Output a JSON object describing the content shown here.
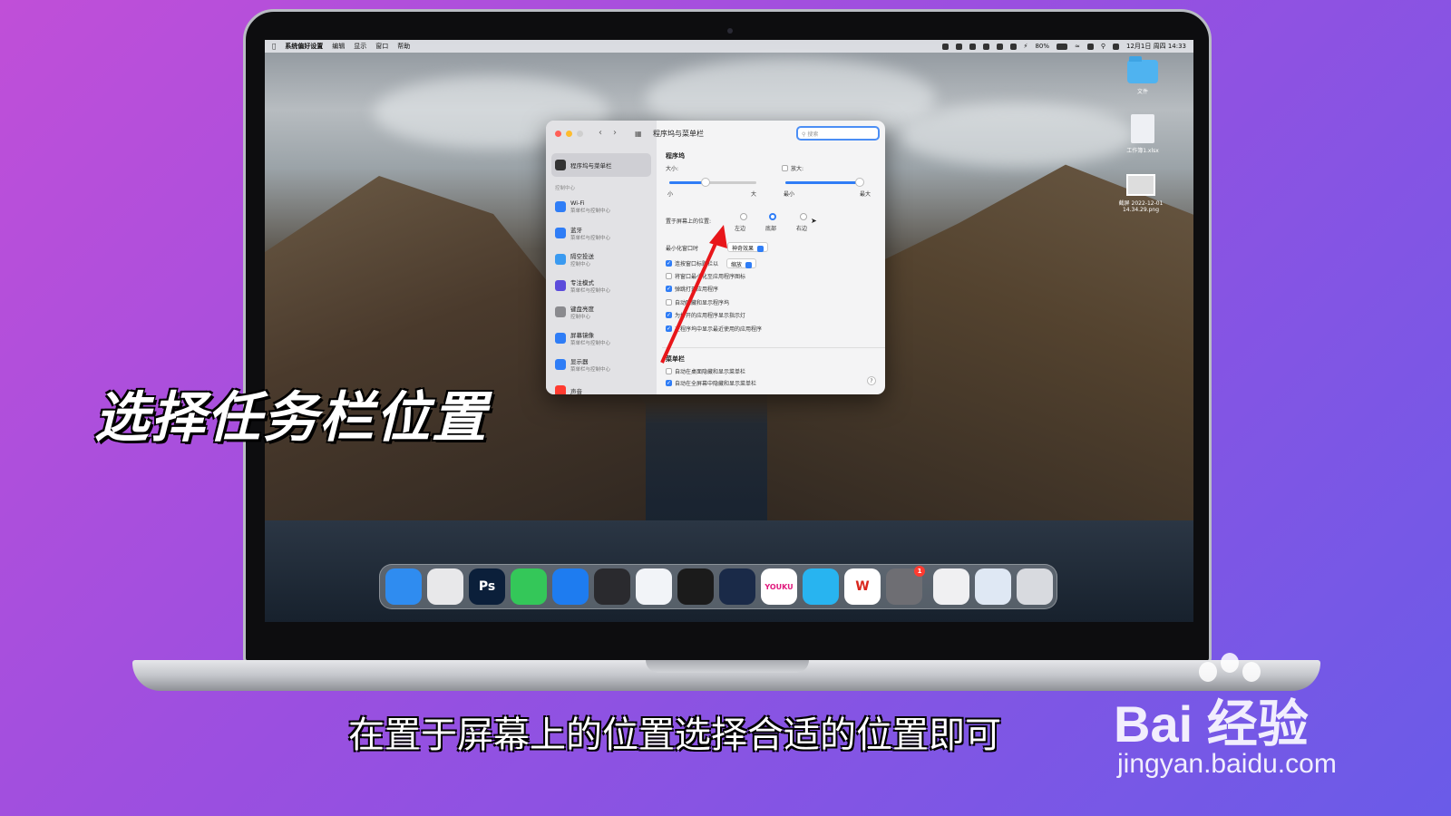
{
  "captions": {
    "title": "选择任务栏位置",
    "subtitle": "在置于屏幕上的位置选择合适的位置即可"
  },
  "watermark": {
    "logo_text": "Bai  经验",
    "url": "jingyan.baidu.com"
  },
  "menubar": {
    "app_name": "系统偏好设置",
    "menus": [
      "编辑",
      "显示",
      "窗口",
      "帮助"
    ],
    "battery": "80%",
    "datetime": "12月1日 周四 14:33"
  },
  "desktop_icons": [
    {
      "label": "文件",
      "icon": "folder-icon"
    },
    {
      "label": "工作簿1.xlsx",
      "icon": "document-icon"
    },
    {
      "label": "截屏 2022-12-01 14.34.29.png",
      "icon": "screenshot-file-icon"
    }
  ],
  "window": {
    "title": "程序坞与菜单栏",
    "search_placeholder": "搜索",
    "sidebar": {
      "active_item": "程序坞与菜单栏",
      "section_label": "控制中心",
      "items": [
        {
          "label": "Wi-Fi",
          "sub": "菜单栏与控制中心",
          "color": "#2f7df6"
        },
        {
          "label": "蓝牙",
          "sub": "菜单栏与控制中心",
          "color": "#2f7df6"
        },
        {
          "label": "隔空投送",
          "sub": "控制中心",
          "color": "#3a9af0"
        },
        {
          "label": "专注模式",
          "sub": "菜单栏与控制中心",
          "color": "#5b4bdb"
        },
        {
          "label": "键盘亮度",
          "sub": "控制中心",
          "color": "#8a8a8e"
        },
        {
          "label": "屏幕镜像",
          "sub": "菜单栏与控制中心",
          "color": "#2f7df6"
        },
        {
          "label": "显示器",
          "sub": "菜单栏与控制中心",
          "color": "#2f7df6"
        },
        {
          "label": "声音",
          "sub": "",
          "color": "#ff3b30"
        }
      ]
    },
    "dock_section": {
      "heading": "程序坞",
      "size_label": "大小:",
      "size_min": "小",
      "size_max": "大",
      "size_value": 0.42,
      "magnify_label": "放大:",
      "magnify_min": "最小",
      "magnify_max": "最大",
      "magnify_value": 0.95,
      "position_label": "置于屏幕上的位置:",
      "positions": [
        "左边",
        "底部",
        "右边"
      ],
      "position_selected": "底部",
      "minimize_label": "最小化窗口时",
      "minimize_effect": "神奇效果",
      "checkboxes": [
        {
          "label": "连按窗口标题栏以",
          "checked": true,
          "popup": "缩放"
        },
        {
          "label": "将窗口最小化至应用程序图标",
          "checked": false
        },
        {
          "label": "弹跳打开应用程序",
          "checked": true
        },
        {
          "label": "自动隐藏和显示程序坞",
          "checked": false
        },
        {
          "label": "为打开的应用程序显示指示灯",
          "checked": true
        },
        {
          "label": "在程序坞中显示最近使用的应用程序",
          "checked": true
        }
      ]
    },
    "menubar_section": {
      "heading": "菜单栏",
      "checkboxes": [
        {
          "label": "自动在桌面隐藏和显示菜单栏",
          "checked": false
        },
        {
          "label": "自动在全屏幕中隐藏和显示菜单栏",
          "checked": true
        }
      ]
    },
    "help": "?"
  },
  "dock": {
    "apps": [
      {
        "name": "finder-icon",
        "label": "",
        "color": "#2f8cf0"
      },
      {
        "name": "launchpad-icon",
        "label": "",
        "color": "#e8e8ea"
      },
      {
        "name": "photoshop-icon",
        "label": "Ps",
        "color": "#0b1f3a"
      },
      {
        "name": "messages-icon",
        "label": "",
        "color": "#34c759"
      },
      {
        "name": "safari-icon",
        "label": "",
        "color": "#1e7cf0"
      },
      {
        "name": "quicktime-icon",
        "label": "",
        "color": "#2a2a2e"
      },
      {
        "name": "feishu-icon",
        "label": "",
        "color": "#f2f4f8"
      },
      {
        "name": "qq-icon",
        "label": "",
        "color": "#1b1b1b"
      },
      {
        "name": "video-player-icon",
        "label": "",
        "color": "#1a2a48"
      },
      {
        "name": "youku-icon",
        "label": "YOUKU",
        "color": "#ffffff"
      },
      {
        "name": "crab-app-icon",
        "label": "",
        "color": "#28b4f0"
      },
      {
        "name": "wps-icon",
        "label": "W",
        "color": "#ffffff"
      },
      {
        "name": "system-preferences-icon",
        "label": "",
        "color": "#6e6e73",
        "badge": "1"
      }
    ],
    "recent": [
      {
        "name": "recent-window-icon",
        "color": "#f0f0f2"
      },
      {
        "name": "recent-document-icon",
        "color": "#dfe8f4"
      },
      {
        "name": "trash-icon",
        "color": "#d8dadf"
      }
    ]
  }
}
